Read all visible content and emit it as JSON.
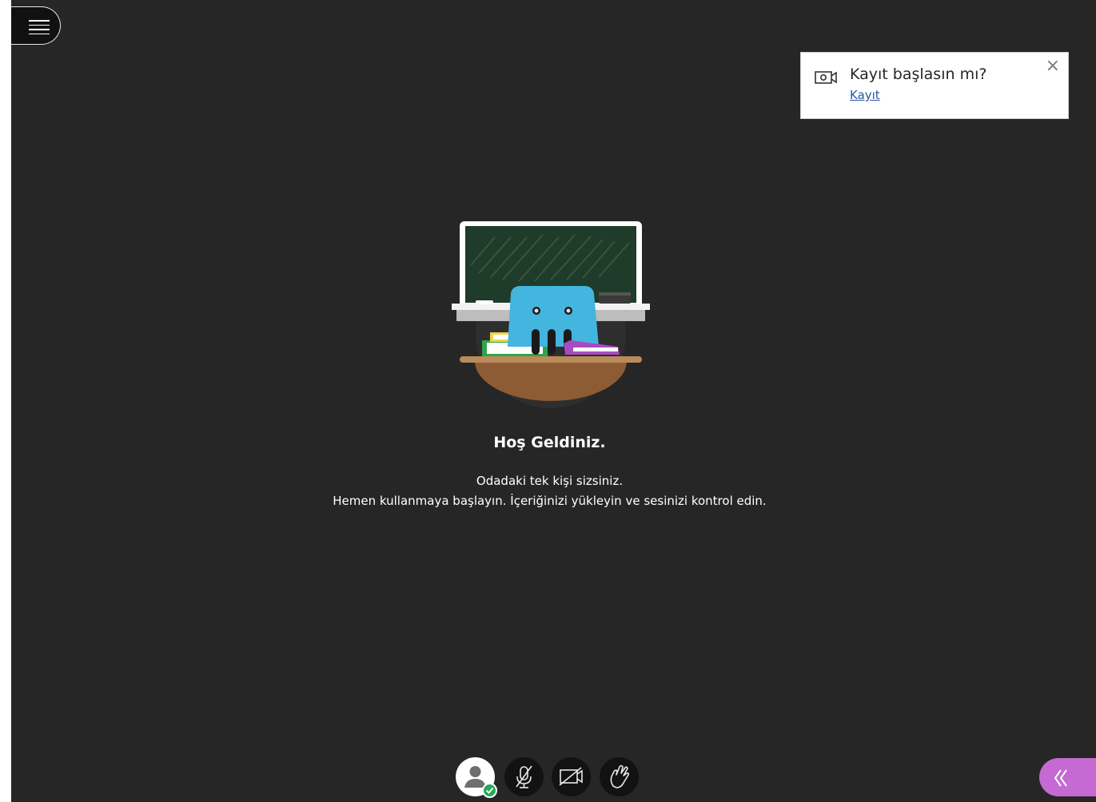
{
  "menu": {
    "icon": "hamburger-menu-icon"
  },
  "toast": {
    "icon": "record-camera-icon",
    "title": "Kayıt başlasın mı?",
    "link_label": "Kayıt",
    "close_label": "×"
  },
  "welcome": {
    "heading": "Hoş Geldiniz.",
    "line1": "Odadaki tek kişi sizsiniz.",
    "line2": "Hemen kullanmaya başlayın. İçeriğinizi yükleyin ve sesinizi kontrol edin."
  },
  "controls": {
    "avatar_icon": "user-avatar-icon",
    "status_icon": "checkmark-icon",
    "mic_icon": "microphone-muted-icon",
    "camera_icon": "camera-off-icon",
    "hand_icon": "raise-hand-icon"
  },
  "panel": {
    "icon": "double-chevron-left-icon",
    "color": "#c46ad2"
  },
  "colors": {
    "background": "#262626",
    "accent": "#c46ad2",
    "status_ok": "#25a95a",
    "link": "#2a57a8"
  }
}
